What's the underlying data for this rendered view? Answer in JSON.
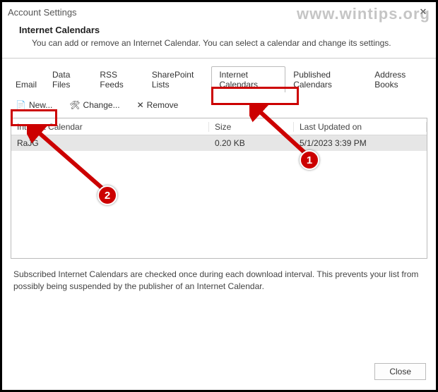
{
  "window": {
    "title": "Account Settings",
    "close": "✕"
  },
  "header": {
    "title": "Internet Calendars",
    "desc": "You can add or remove an Internet Calendar. You can select a calendar and change its settings."
  },
  "tabs": [
    {
      "label": "Email"
    },
    {
      "label": "Data Files"
    },
    {
      "label": "RSS Feeds"
    },
    {
      "label": "SharePoint Lists"
    },
    {
      "label": "Internet Calendars",
      "active": true
    },
    {
      "label": "Published Calendars"
    },
    {
      "label": "Address Books"
    }
  ],
  "toolbar": {
    "new": {
      "icon": "📄",
      "label": "New..."
    },
    "change": {
      "icon": "🛠",
      "label": "Change..."
    },
    "remove": {
      "icon": "✕",
      "label": "Remove"
    }
  },
  "grid": {
    "columns": [
      "Internet Calendar",
      "Size",
      "Last Updated on"
    ],
    "rows": [
      {
        "name": "RaJG",
        "size": "0.20 KB",
        "updated": "5/1/2023 3:39 PM",
        "selected": true
      }
    ]
  },
  "footer": {
    "text": "Subscribed Internet Calendars are checked once during each download interval. This prevents your list from possibly being suspended by the publisher of an Internet Calendar."
  },
  "buttons": {
    "close": "Close"
  },
  "annotations": {
    "watermark": "www.wintips.org",
    "badge1": "1",
    "badge2": "2"
  }
}
